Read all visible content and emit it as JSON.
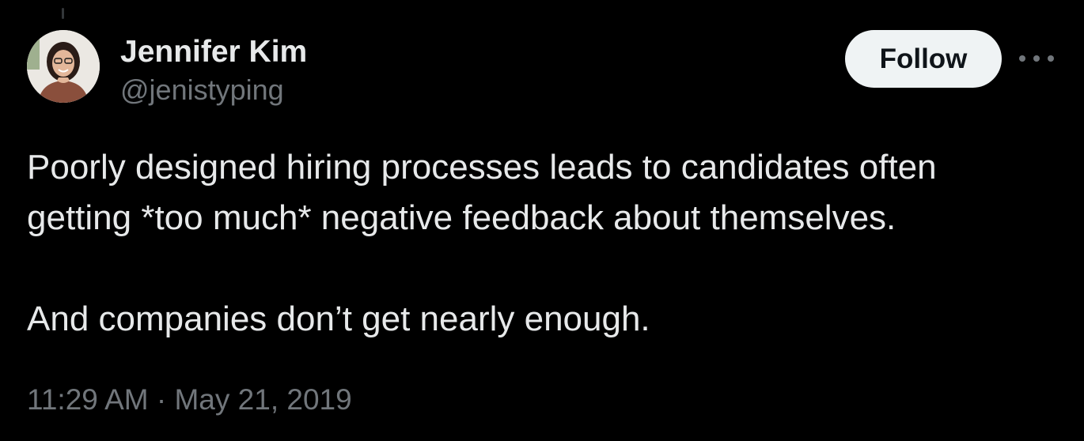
{
  "author": {
    "display_name": "Jennifer Kim",
    "handle": "@jenistyping",
    "avatar": "profile-photo"
  },
  "actions": {
    "follow_label": "Follow",
    "more_icon": "more-horizontal-icon"
  },
  "tweet": {
    "paragraph_1": "Poorly designed hiring processes leads to candidates often\ngetting *too much* negative feedback about themselves.",
    "paragraph_2": "And companies don’t get nearly enough.",
    "time": "11:29 AM",
    "separator": " · ",
    "date": "May 21, 2019"
  },
  "colors": {
    "background": "#000000",
    "primary_text": "#e7e9ea",
    "secondary_text": "#71767b",
    "follow_button_bg": "#eff3f4",
    "follow_button_text": "#0f1419"
  }
}
